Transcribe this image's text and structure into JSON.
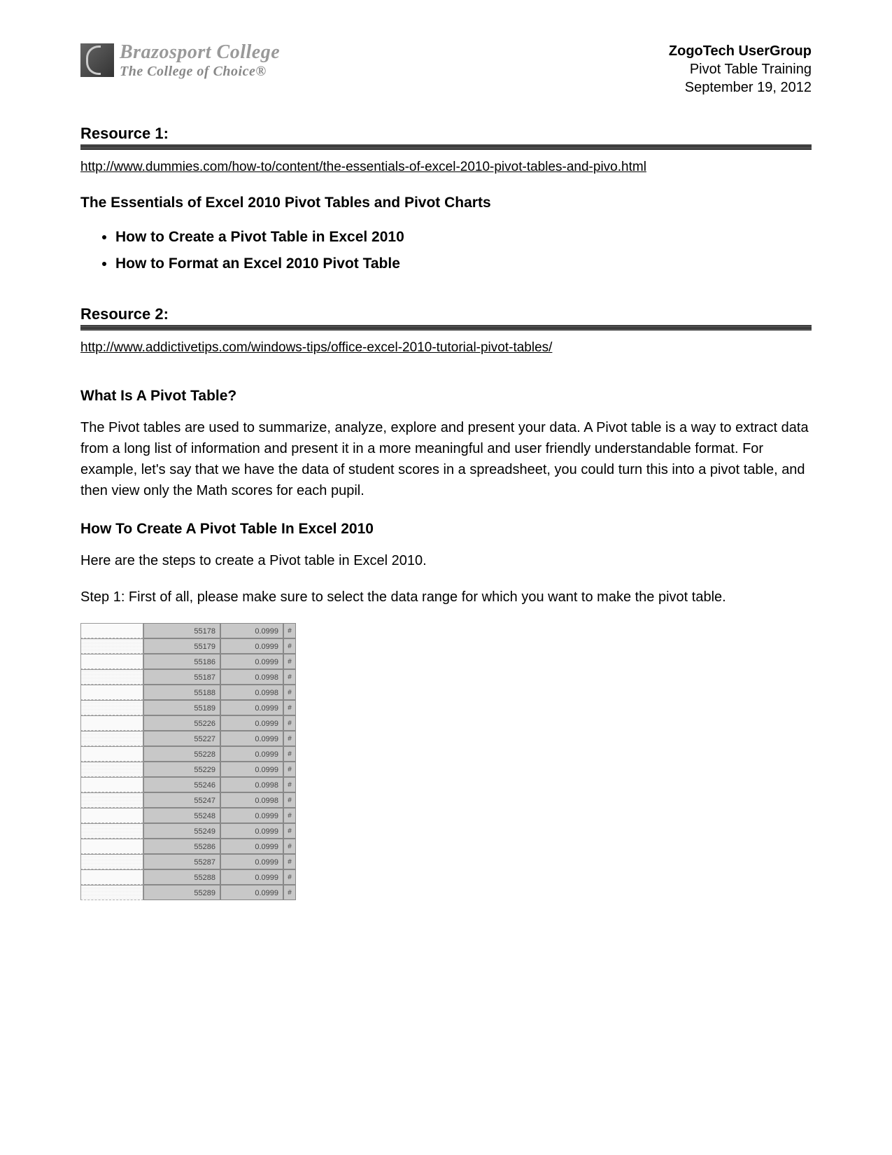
{
  "header": {
    "logo": {
      "line1": "Brazosport College",
      "line2": "The College of Choice®"
    },
    "right": {
      "line1": "ZogoTech UserGroup",
      "line2": "Pivot Table Training",
      "line3": "September 19, 2012"
    }
  },
  "resource1": {
    "heading": "Resource 1:",
    "url": "http://www.dummies.com/how-to/content/the-essentials-of-excel-2010-pivot-tables-and-pivo.html",
    "subheading": "The Essentials of Excel 2010 Pivot Tables and Pivot Charts",
    "bullets": [
      "How to Create a Pivot Table in Excel 2010",
      "How to Format an Excel 2010 Pivot Table"
    ]
  },
  "resource2": {
    "heading": "Resource 2:",
    "url": "http://www.addictivetips.com/windows-tips/office-excel-2010-tutorial-pivot-tables/",
    "q1": "What Is A Pivot Table?",
    "p1": "The Pivot tables are used to summarize, analyze, explore and present your data. A Pivot table is a way to extract data from a long list of information and present it in a more meaningful and user friendly understandable format. For example, let's say that we have the data of student scores in a spreadsheet, you could turn this into a pivot table, and then view only the Math scores for each pupil.",
    "q2": "How To Create A Pivot Table In Excel 2010",
    "p2": "Here are the steps to create a Pivot table in Excel 2010.",
    "p3": "Step 1: First of all, please make sure to select the data range for which you want to make the pivot table."
  },
  "excel_rows": [
    {
      "b": "55178",
      "c": "0.0999",
      "d": "#"
    },
    {
      "b": "55179",
      "c": "0.0999",
      "d": "#"
    },
    {
      "b": "55186",
      "c": "0.0999",
      "d": "#"
    },
    {
      "b": "55187",
      "c": "0.0998",
      "d": "#"
    },
    {
      "b": "55188",
      "c": "0.0998",
      "d": "#"
    },
    {
      "b": "55189",
      "c": "0.0999",
      "d": "#"
    },
    {
      "b": "55226",
      "c": "0.0999",
      "d": "#"
    },
    {
      "b": "55227",
      "c": "0.0999",
      "d": "#"
    },
    {
      "b": "55228",
      "c": "0.0999",
      "d": "#"
    },
    {
      "b": "55229",
      "c": "0.0999",
      "d": "#"
    },
    {
      "b": "55246",
      "c": "0.0998",
      "d": "#"
    },
    {
      "b": "55247",
      "c": "0.0998",
      "d": "#"
    },
    {
      "b": "55248",
      "c": "0.0999",
      "d": "#"
    },
    {
      "b": "55249",
      "c": "0.0999",
      "d": "#"
    },
    {
      "b": "55286",
      "c": "0.0999",
      "d": "#"
    },
    {
      "b": "55287",
      "c": "0.0999",
      "d": "#"
    },
    {
      "b": "55288",
      "c": "0.0999",
      "d": "#"
    },
    {
      "b": "55289",
      "c": "0.0999",
      "d": "#"
    }
  ]
}
